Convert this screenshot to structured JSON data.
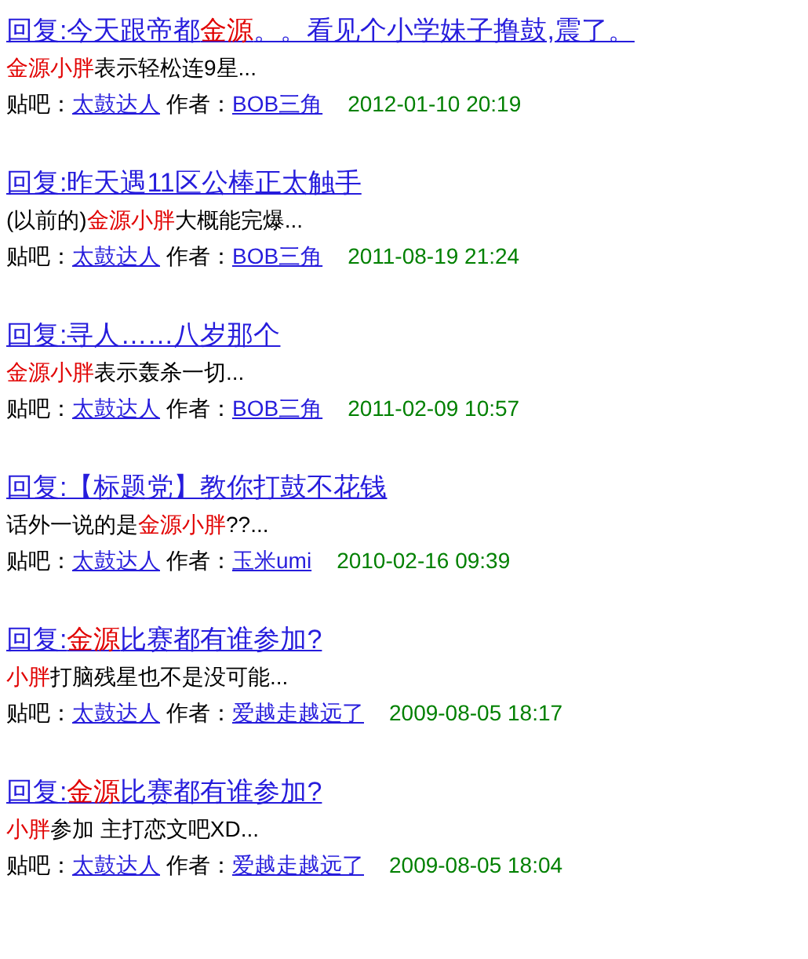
{
  "results": [
    {
      "title": [
        {
          "text": "回复:今天跟帝都",
          "highlight": false
        },
        {
          "text": "金源",
          "highlight": true
        },
        {
          "text": "。。看见个小学妹子撸鼓,震了。",
          "highlight": false
        }
      ],
      "snippet": [
        {
          "text": "金源小胖",
          "highlight": true
        },
        {
          "text": "表示轻松连9星...",
          "highlight": false
        }
      ],
      "forum_label": "贴吧：",
      "forum": "太鼓达人",
      "author_label": "作者：",
      "author": "BOB三角",
      "time": "2012-01-10 20:19"
    },
    {
      "title": [
        {
          "text": "回复:昨天遇11区公棒正太触手",
          "highlight": false
        }
      ],
      "snippet": [
        {
          "text": "(以前的)",
          "highlight": false
        },
        {
          "text": "金源小胖",
          "highlight": true
        },
        {
          "text": "大概能完爆...",
          "highlight": false
        }
      ],
      "forum_label": "贴吧：",
      "forum": "太鼓达人",
      "author_label": "作者：",
      "author": "BOB三角",
      "time": "2011-08-19 21:24"
    },
    {
      "title": [
        {
          "text": "回复:寻人……八岁那个",
          "highlight": false
        }
      ],
      "snippet": [
        {
          "text": "金源小胖",
          "highlight": true
        },
        {
          "text": "表示轰杀一切...",
          "highlight": false
        }
      ],
      "forum_label": "贴吧：",
      "forum": "太鼓达人",
      "author_label": "作者：",
      "author": "BOB三角",
      "time": "2011-02-09 10:57"
    },
    {
      "title": [
        {
          "text": "回复:【标题党】教你打鼓不花钱",
          "highlight": false
        }
      ],
      "snippet": [
        {
          "text": "话外一说的是",
          "highlight": false
        },
        {
          "text": "金源小胖",
          "highlight": true
        },
        {
          "text": "??...",
          "highlight": false
        }
      ],
      "forum_label": "贴吧：",
      "forum": "太鼓达人",
      "author_label": "作者：",
      "author": "玉米umi",
      "time": "2010-02-16 09:39"
    },
    {
      "title": [
        {
          "text": "回复:",
          "highlight": false
        },
        {
          "text": "金源",
          "highlight": true
        },
        {
          "text": "比赛都有谁参加?",
          "highlight": false
        }
      ],
      "snippet": [
        {
          "text": "小胖",
          "highlight": true
        },
        {
          "text": "打脑残星也不是没可能...",
          "highlight": false
        }
      ],
      "forum_label": "贴吧：",
      "forum": "太鼓达人",
      "author_label": "作者：",
      "author": "爱越走越远了",
      "time": "2009-08-05 18:17"
    },
    {
      "title": [
        {
          "text": "回复:",
          "highlight": false
        },
        {
          "text": "金源",
          "highlight": true
        },
        {
          "text": "比赛都有谁参加?",
          "highlight": false
        }
      ],
      "snippet": [
        {
          "text": "小胖",
          "highlight": true
        },
        {
          "text": "参加 主打恋文吧XD...",
          "highlight": false
        }
      ],
      "forum_label": "贴吧：",
      "forum": "太鼓达人",
      "author_label": "作者：",
      "author": "爱越走越远了",
      "time": "2009-08-05 18:04"
    }
  ]
}
